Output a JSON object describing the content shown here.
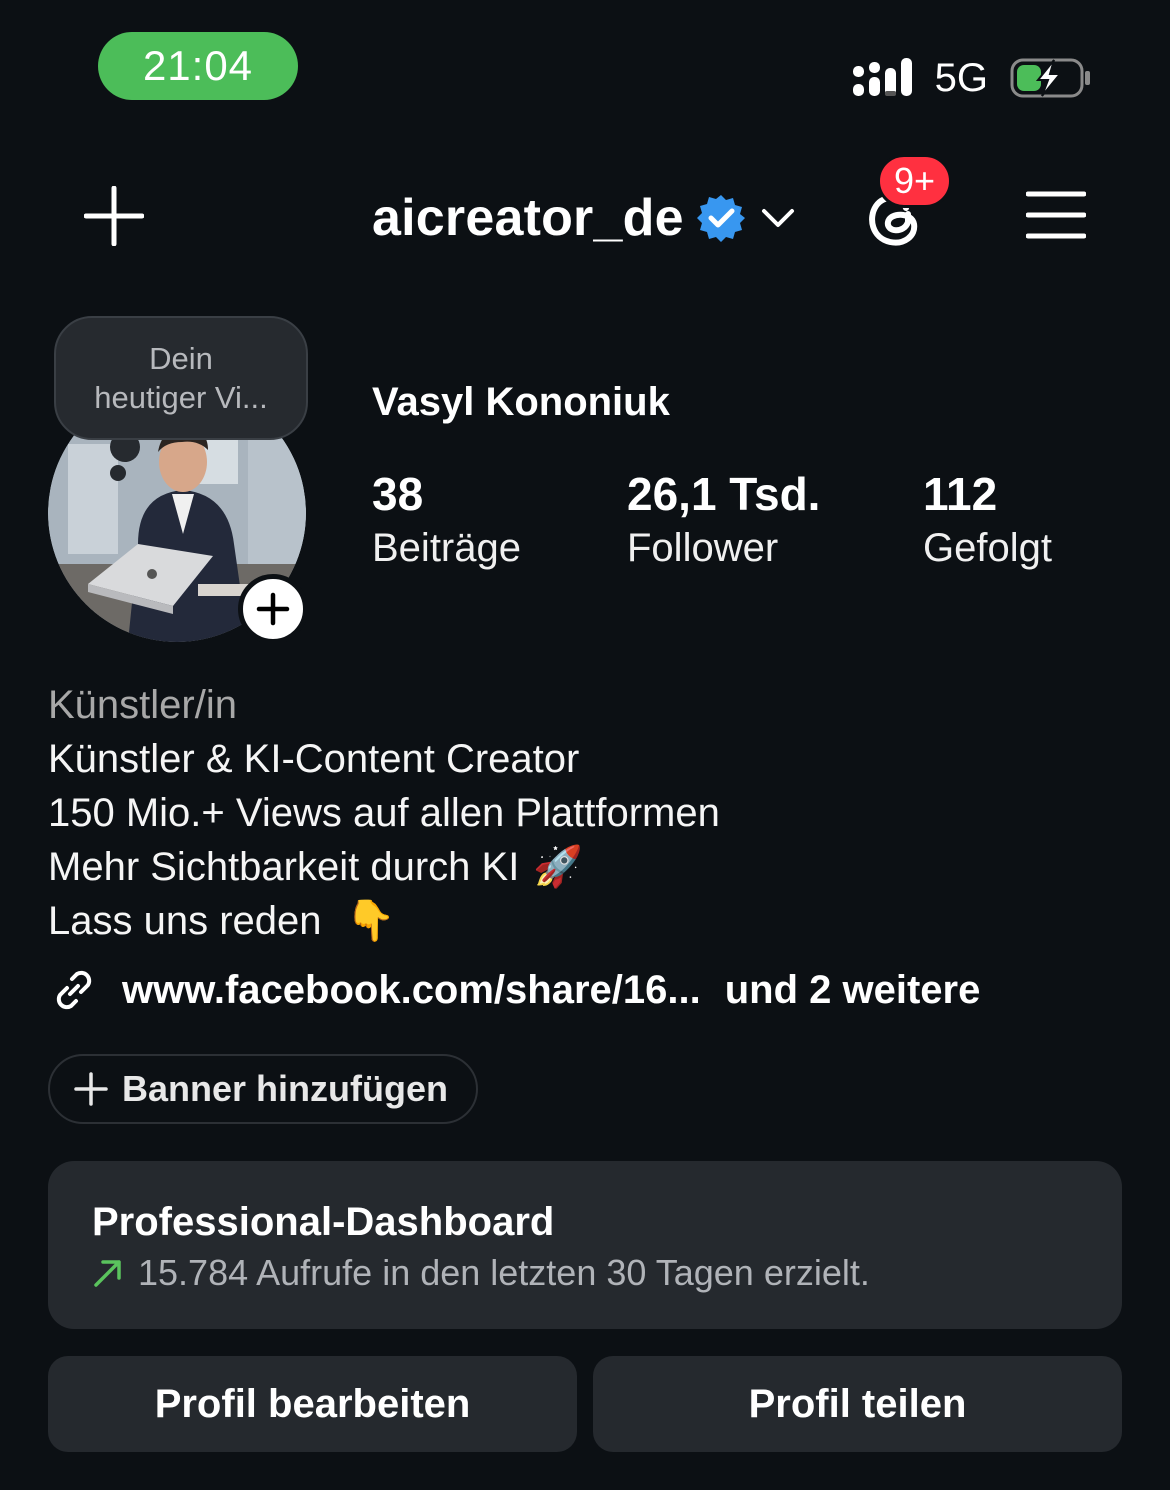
{
  "status_bar": {
    "time": "21:04",
    "network": "5G"
  },
  "header": {
    "username": "aicreator_de",
    "notification_badge": "9+",
    "icons": [
      "plus-icon",
      "verified-badge-icon",
      "chevron-down-icon",
      "threads-icon",
      "menu-icon"
    ]
  },
  "profile": {
    "note_line1": "Dein",
    "note_line2": "heutiger Vi...",
    "display_name": "Vasyl Kononiuk",
    "stats": [
      {
        "value": "38",
        "label": "Beiträge"
      },
      {
        "value": "26,1 Tsd.",
        "label": "Follower"
      },
      {
        "value": "112",
        "label": "Gefolgt"
      }
    ]
  },
  "bio": {
    "category": "Künstler/in",
    "line1": "Künstler & KI-Content Creator",
    "line2": "150 Mio.+ Views auf allen Plattformen",
    "line3": "Mehr Sichtbarkeit durch KI",
    "line3_emoji": "🚀",
    "line4": "Lass uns reden",
    "line4_emoji": "👇"
  },
  "link": {
    "url": "www.facebook.com/share/16...",
    "more": "und 2 weitere"
  },
  "banner_button": "Banner hinzufügen",
  "dashboard": {
    "title": "Professional-Dashboard",
    "subtitle": "15.784 Aufrufe in den letzten 30 Tagen erzielt."
  },
  "buttons": {
    "edit": "Profil bearbeiten",
    "share": "Profil teilen"
  },
  "colors": {
    "background": "#0c1014",
    "time_pill": "#4cbd59",
    "badge": "#ff3040",
    "verified": "#3897f0",
    "card": "#25292e",
    "trend": "#5ac35d"
  }
}
